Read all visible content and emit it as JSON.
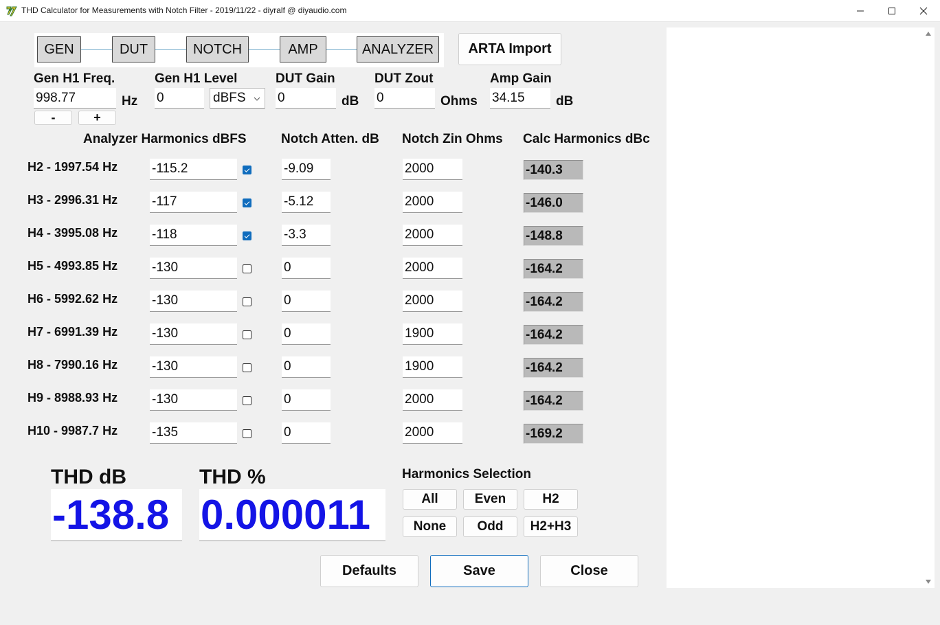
{
  "window": {
    "title": "THD Calculator for Measurements with Notch Filter - 2019/11/22 - diyralf @ diyaudio.com"
  },
  "flow": {
    "boxes": [
      "GEN",
      "DUT",
      "NOTCH",
      "AMP",
      "ANALYZER"
    ],
    "arta_import": "ARTA Import"
  },
  "params": {
    "gen_freq": {
      "label": "Gen H1 Freq.",
      "value": "998.77",
      "unit": "Hz",
      "minus": "-",
      "plus": "+"
    },
    "gen_level": {
      "label": "Gen H1 Level",
      "value": "0",
      "select": "dBFS"
    },
    "dut_gain": {
      "label": "DUT Gain",
      "value": "0",
      "unit": "dB"
    },
    "dut_zout": {
      "label": "DUT Zout",
      "value": "0",
      "unit": "Ohms"
    },
    "amp_gain": {
      "label": "Amp Gain",
      "value": "34.15",
      "unit": "dB"
    }
  },
  "table": {
    "headers": {
      "analyzer": "Analyzer Harmonics dBFS",
      "notch_atten": "Notch Atten. dB",
      "notch_zin": "Notch Zin Ohms",
      "calc": "Calc Harmonics dBc"
    },
    "rows": [
      {
        "label": "H2 - 1997.54 Hz",
        "analyzer": "-115.2",
        "checked": true,
        "atten": "-9.09",
        "zin": "2000",
        "calc": "-140.3"
      },
      {
        "label": "H3 - 2996.31 Hz",
        "analyzer": "-117",
        "checked": true,
        "atten": "-5.12",
        "zin": "2000",
        "calc": "-146.0"
      },
      {
        "label": "H4 - 3995.08 Hz",
        "analyzer": "-118",
        "checked": true,
        "atten": "-3.3",
        "zin": "2000",
        "calc": "-148.8"
      },
      {
        "label": "H5 - 4993.85 Hz",
        "analyzer": "-130",
        "checked": false,
        "atten": "0",
        "zin": "2000",
        "calc": "-164.2"
      },
      {
        "label": "H6 - 5992.62 Hz",
        "analyzer": "-130",
        "checked": false,
        "atten": "0",
        "zin": "2000",
        "calc": "-164.2"
      },
      {
        "label": "H7 - 6991.39 Hz",
        "analyzer": "-130",
        "checked": false,
        "atten": "0",
        "zin": "1900",
        "calc": "-164.2"
      },
      {
        "label": "H8 - 7990.16 Hz",
        "analyzer": "-130",
        "checked": false,
        "atten": "0",
        "zin": "1900",
        "calc": "-164.2"
      },
      {
        "label": "H9 - 8988.93 Hz",
        "analyzer": "-130",
        "checked": false,
        "atten": "0",
        "zin": "2000",
        "calc": "-164.2"
      },
      {
        "label": "H10 - 9987.7 Hz",
        "analyzer": "-135",
        "checked": false,
        "atten": "0",
        "zin": "2000",
        "calc": "-169.2"
      }
    ]
  },
  "results": {
    "thd_db_label": "THD dB",
    "thd_db": "-138.8",
    "thd_pct_label": "THD %",
    "thd_pct": "0.000011"
  },
  "harmonics_selection": {
    "title": "Harmonics Selection",
    "buttons": [
      "All",
      "Even",
      "H2",
      "None",
      "Odd",
      "H2+H3"
    ]
  },
  "actions": {
    "defaults": "Defaults",
    "save": "Save",
    "close": "Close"
  },
  "colors": {
    "result_blue": "#1414e6",
    "calc_field": "#b9b9b9",
    "checkbox_on": "#0f6cbd",
    "flow_line": "#7aaecd"
  }
}
